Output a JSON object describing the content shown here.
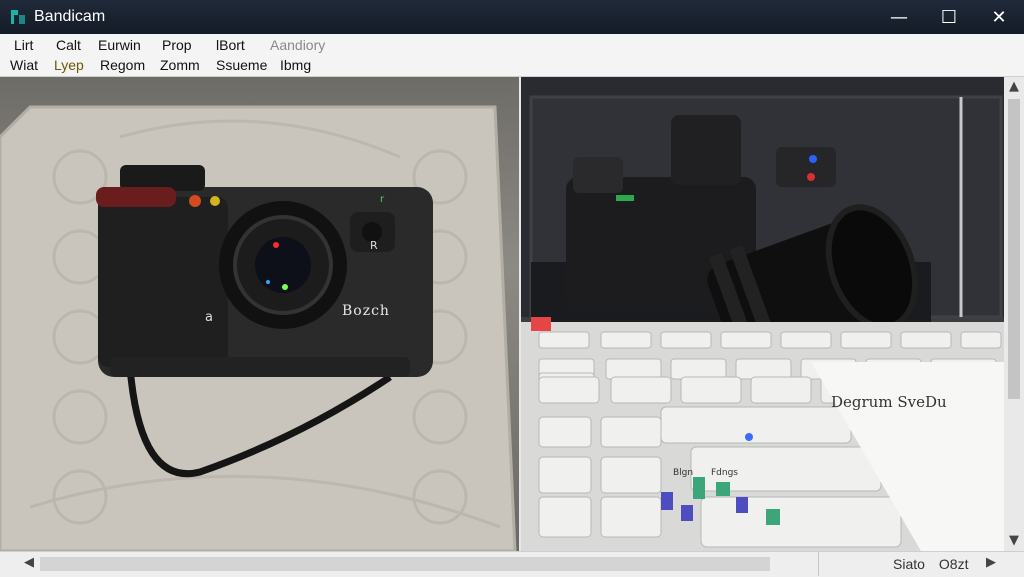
{
  "window": {
    "title": "Bandicam"
  },
  "window_controls": {
    "minimize": "—",
    "maximize": "☐",
    "close": "✕"
  },
  "menu": {
    "row1": [
      "Lirt",
      "Calt",
      "Eurwin",
      "Prop",
      "lBort",
      "Aandiory"
    ],
    "row2": [
      "Wiat",
      "Lyep",
      "Regom",
      "Zomm",
      "Ssueme",
      "Ibmg"
    ]
  },
  "scene": {
    "camera_left_brand": "Bozch",
    "camera_left_button": "R",
    "camera_left_letter": "a",
    "laptop_screen_text": "Degrum SveDu",
    "laptop_small_labels": [
      "Blgn",
      "Fdngs"
    ]
  },
  "status": {
    "left": "Siato",
    "right": "O8zt"
  },
  "colors": {
    "titlebar": "#141b27",
    "menubar": "#f4f4f4",
    "accent": "#00a3a3"
  },
  "icons": {
    "app": "bandicam-logo-icon",
    "scroll_left": "arrow-left-icon",
    "scroll_right": "arrow-right-icon",
    "scroll_up": "arrow-up-icon",
    "scroll_down": "arrow-down-icon"
  }
}
